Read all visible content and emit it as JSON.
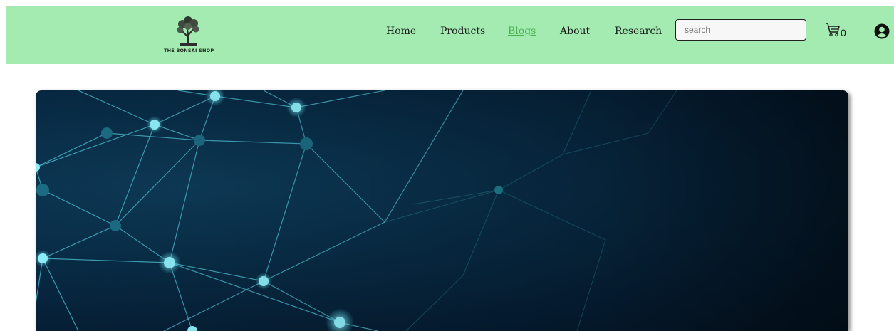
{
  "brand": {
    "logo_text": "THE BONSAI SHOP"
  },
  "nav": {
    "items": [
      {
        "label": "Home",
        "active": false
      },
      {
        "label": "Products",
        "active": false
      },
      {
        "label": "Blogs",
        "active": true
      },
      {
        "label": "About",
        "active": false
      },
      {
        "label": "Research",
        "active": false
      }
    ]
  },
  "search": {
    "placeholder": "search"
  },
  "cart": {
    "count": "0",
    "icon": "cart-icon"
  },
  "profile": {
    "icon": "user-avatar-icon"
  },
  "banner": {
    "image": "network-nodes-illustration"
  },
  "colors": {
    "navbar_bg": "#a3ebb1",
    "active_link": "#4caf50",
    "banner_bg": "#082b45",
    "node": "#7fe3f0"
  }
}
